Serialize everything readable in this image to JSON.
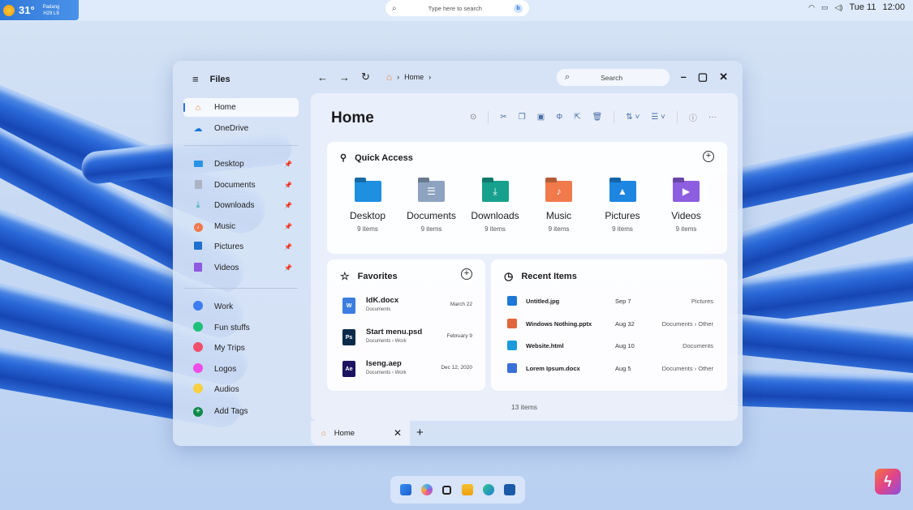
{
  "system": {
    "weather": {
      "temp": "31°",
      "location": "Padang",
      "range": "H29 L9"
    },
    "search_placeholder": "Type here to search",
    "tray": {
      "wifi": "wifi-icon",
      "battery": "battery-icon",
      "volume": "volume-icon",
      "date": "Tue 11",
      "time": "12:00"
    }
  },
  "window": {
    "app_title": "Files",
    "breadcrumb": [
      "Home"
    ],
    "search_placeholder": "Search",
    "page_title": "Home",
    "status": "13 items"
  },
  "sidebar": {
    "main": [
      {
        "label": "Home",
        "icon": "home-icon",
        "active": true
      },
      {
        "label": "OneDrive",
        "icon": "onedrive-icon"
      }
    ],
    "pinned": [
      {
        "label": "Desktop",
        "icon": "desktop-folder-icon"
      },
      {
        "label": "Documents",
        "icon": "documents-icon"
      },
      {
        "label": "Downloads",
        "icon": "download-icon"
      },
      {
        "label": "Music",
        "icon": "music-icon"
      },
      {
        "label": "Pictures",
        "icon": "pictures-icon"
      },
      {
        "label": "Videos",
        "icon": "videos-icon"
      }
    ],
    "tags": [
      {
        "label": "Work",
        "color": "#3d7df0"
      },
      {
        "label": "Fun stuffs",
        "color": "#1fc07a"
      },
      {
        "label": "My Trips",
        "color": "#f0506e"
      },
      {
        "label": "Logos",
        "color": "#ee4de8"
      },
      {
        "label": "Audios",
        "color": "#f8d040"
      }
    ],
    "add_tags": "Add Tags"
  },
  "quick_access": {
    "title": "Quick Access",
    "items": [
      {
        "name": "Desktop",
        "count": "9 items",
        "color": "#1f8fe0"
      },
      {
        "name": "Documents",
        "count": "9 items",
        "color": "#8ea3c0"
      },
      {
        "name": "Downloads",
        "count": "9 items",
        "color": "#17a08c"
      },
      {
        "name": "Music",
        "count": "9 items",
        "color": "#f07a4c"
      },
      {
        "name": "Pictures",
        "count": "9 items",
        "color": "#1d86e0"
      },
      {
        "name": "Videos",
        "count": "9 items",
        "color": "#8d5ee0"
      }
    ]
  },
  "favorites": {
    "title": "Favorites",
    "items": [
      {
        "name": "IdK.docx",
        "path": "Documents",
        "date": "March 22",
        "type": "W",
        "color": "#3b7ee0"
      },
      {
        "name": "Start menu.psd",
        "path": "Documents › Work",
        "date": "February 9",
        "type": "Ps",
        "color": "#0b2a4a"
      },
      {
        "name": "Iseng.aep",
        "path": "Documents › Work",
        "date": "Dec 12, 2020",
        "type": "Ae",
        "color": "#1c1460"
      }
    ]
  },
  "recent": {
    "title": "Recent Items",
    "items": [
      {
        "name": "Untitled.jpg",
        "date": "Sep 7",
        "location": "Pictures",
        "color": "#1d78d8"
      },
      {
        "name": "Windows Nothing.pptx",
        "date": "Aug 32",
        "location": "Documents › Other",
        "color": "#e0653c"
      },
      {
        "name": "Website.html",
        "date": "Aug 10",
        "location": "Documents",
        "color": "#1a9ad8"
      },
      {
        "name": "Lorem Ipsum.docx",
        "date": "Aug 5",
        "location": "Documents › Other",
        "color": "#3b6fd8"
      }
    ]
  },
  "tabs": [
    {
      "label": "Home"
    }
  ],
  "taskbar": [
    "start-icon",
    "copilot-icon",
    "task-view-icon",
    "file-explorer-icon",
    "edge-icon",
    "store-icon"
  ]
}
